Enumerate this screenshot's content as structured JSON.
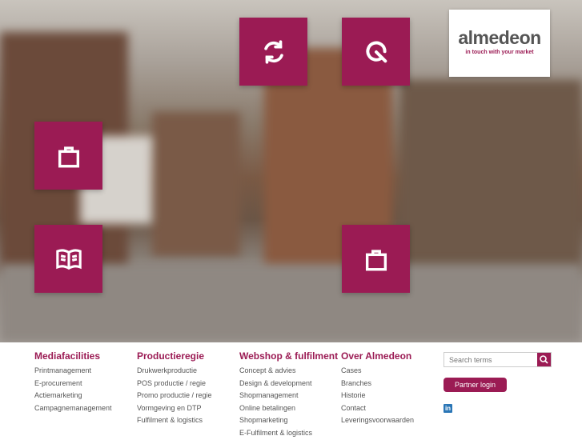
{
  "logo": {
    "name": "almedeon",
    "tagline": "in touch with your market"
  },
  "tiles": [
    {
      "icon": "refresh-icon"
    },
    {
      "icon": "q-logo-icon"
    },
    {
      "icon": "shopping-bag-icon"
    },
    {
      "icon": "open-book-icon"
    },
    {
      "icon": "shopping-bag-icon"
    }
  ],
  "footer": {
    "columns": [
      {
        "title": "Mediafacilities",
        "items": [
          "Printmanagement",
          "E-procurement",
          "Actiemarketing",
          "Campagnemanagement"
        ]
      },
      {
        "title": "Productieregie",
        "items": [
          "Drukwerkproductie",
          "POS productie / regie",
          "Promo productie / regie",
          "Vormgeving en DTP",
          "Fulfilment & logistics"
        ]
      },
      {
        "title": "Webshop & fulfilment",
        "items": [
          "Concept & advies",
          "Design & development",
          "Shopmanagement",
          "Online betalingen",
          "Shopmarketing",
          "E-Fulfilment & logistics"
        ]
      },
      {
        "title": "Over Almedeon",
        "items": [
          "Cases",
          "Branches",
          "Historie",
          "Contact",
          "Leveringsvoorwaarden"
        ]
      }
    ],
    "search": {
      "placeholder": "Search terms"
    },
    "login_label": "Partner login",
    "social": {
      "linkedin": "in"
    }
  },
  "colors": {
    "accent": "#9b1b54"
  }
}
